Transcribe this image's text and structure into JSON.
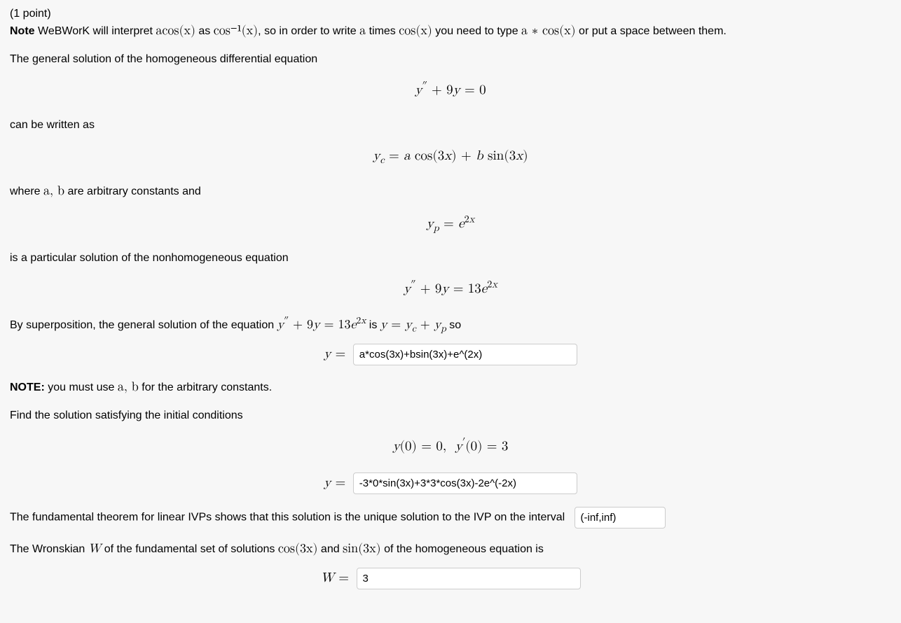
{
  "header": {
    "points": "(1 point)",
    "note_label": "Note",
    "note_text_1": " WeBWorK will interpret ",
    "note_math_1": "acos(x)",
    "note_text_2": " as ",
    "note_math_2": "cos⁻¹(x)",
    "note_text_3": ", so in order to write ",
    "note_math_a": "a",
    "note_text_4": " times ",
    "note_math_cos": "cos(x)",
    "note_text_5": " you need to type ",
    "note_math_star": "a ∗ cos(x)",
    "note_text_6": " or put a space between them."
  },
  "body": {
    "line1": "The general solution of the homogeneous differential equation",
    "eq1": "y″ + 9y = 0",
    "line2": "can be written as",
    "eq2": "yᶜ = a cos(3x) + b sin(3x)",
    "line3_a": "where ",
    "line3_m": "a, b",
    "line3_b": " are arbitrary constants and",
    "eq3": "yₚ = e²ˣ",
    "line4": "is a particular solution of the nonhomogeneous equation",
    "eq4": "y″ + 9y = 13e²ˣ",
    "line5_a": "By superposition, the general solution of the equation ",
    "line5_m1": "y″ + 9y = 13e²ˣ",
    "line5_b": " is ",
    "line5_m2": "y = yᶜ + yₚ",
    "line5_c": " so",
    "input1_lhs": "y =",
    "input1_value": "a*cos(3x)+bsin(3x)+e^(2x)",
    "note2_label": "NOTE:",
    "note2_a": " you must use ",
    "note2_m": "a, b",
    "note2_b": " for the arbitrary constants.",
    "line6": "Find the solution satisfying the initial conditions",
    "eq5": "y(0) = 0, y′(0) = 3",
    "input2_lhs": "y =",
    "input2_value": "-3*0*sin(3x)+3*3*cos(3x)-2e^(-2x)",
    "line7": "The fundamental theorem for linear IVPs shows that this solution is the unique solution to the IVP on the interval",
    "input3_value": "(-inf,inf)",
    "line8_a": "The Wronskian ",
    "line8_w": "W",
    "line8_b": " of the fundamental set of solutions ",
    "line8_m1": "cos(3x)",
    "line8_c": " and ",
    "line8_m2": "sin(3x)",
    "line8_d": " of the homogeneous equation is",
    "input4_lhs": "W =",
    "input4_value": "3"
  }
}
